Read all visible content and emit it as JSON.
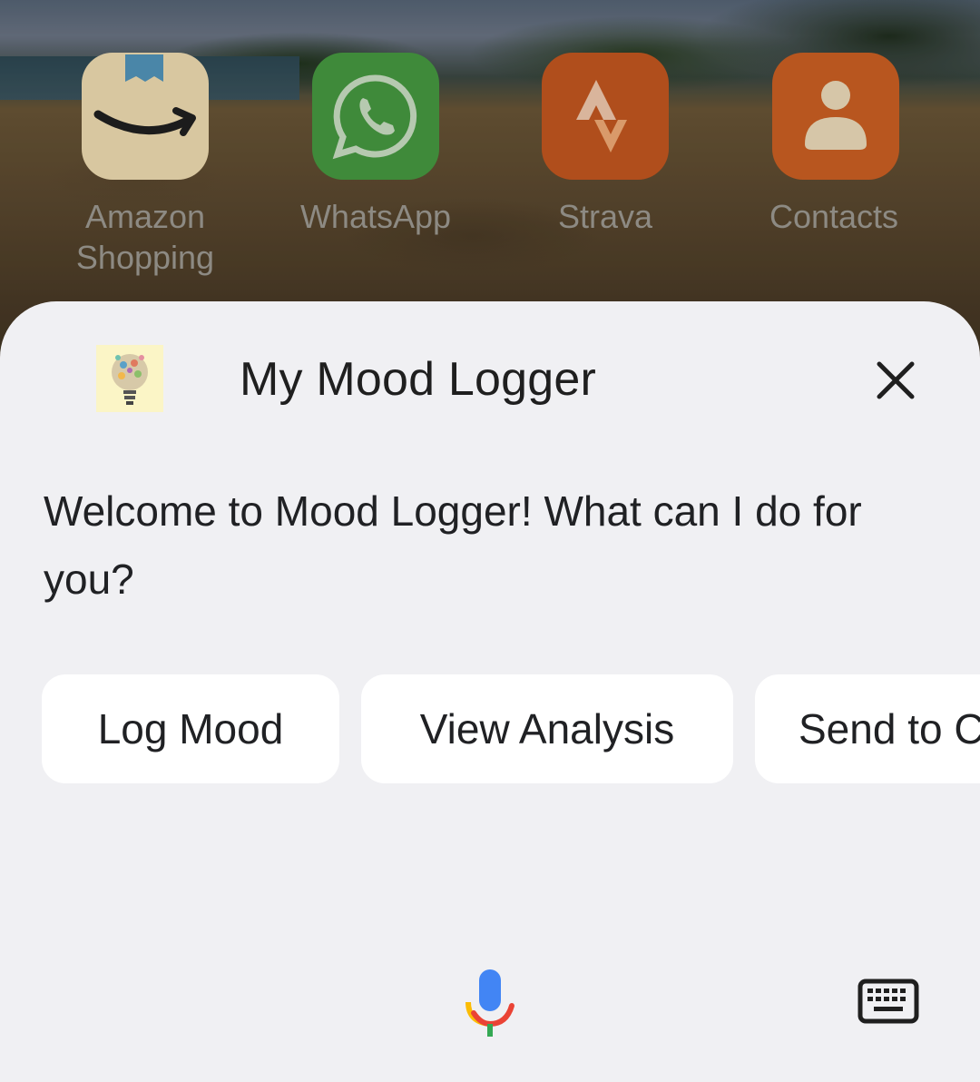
{
  "home_apps": [
    {
      "label_line1": "Amazon",
      "label_line2": "Shopping",
      "icon": "amazon-smile-icon"
    },
    {
      "label": "WhatsApp",
      "icon": "whatsapp-icon"
    },
    {
      "label": "Strava",
      "icon": "strava-icon"
    },
    {
      "label": "Contacts",
      "icon": "contacts-person-icon"
    }
  ],
  "assistant_sheet": {
    "title": "My Mood Logger",
    "logo_icon": "lightbulb-logo-icon",
    "close_icon": "close-icon",
    "message": "Welcome to Mood Logger! What can I do for you?",
    "suggestions": [
      "Log Mood",
      "View Analysis",
      "Send to C"
    ],
    "mic_icon": "microphone-icon",
    "keyboard_icon": "keyboard-icon"
  },
  "colors": {
    "sheet_background": "#f0f0f3",
    "chip_background": "#ffffff",
    "mic_blue": "#4285f4",
    "mic_red": "#ea4335",
    "mic_yellow": "#fbbc04",
    "mic_green": "#34a853"
  }
}
